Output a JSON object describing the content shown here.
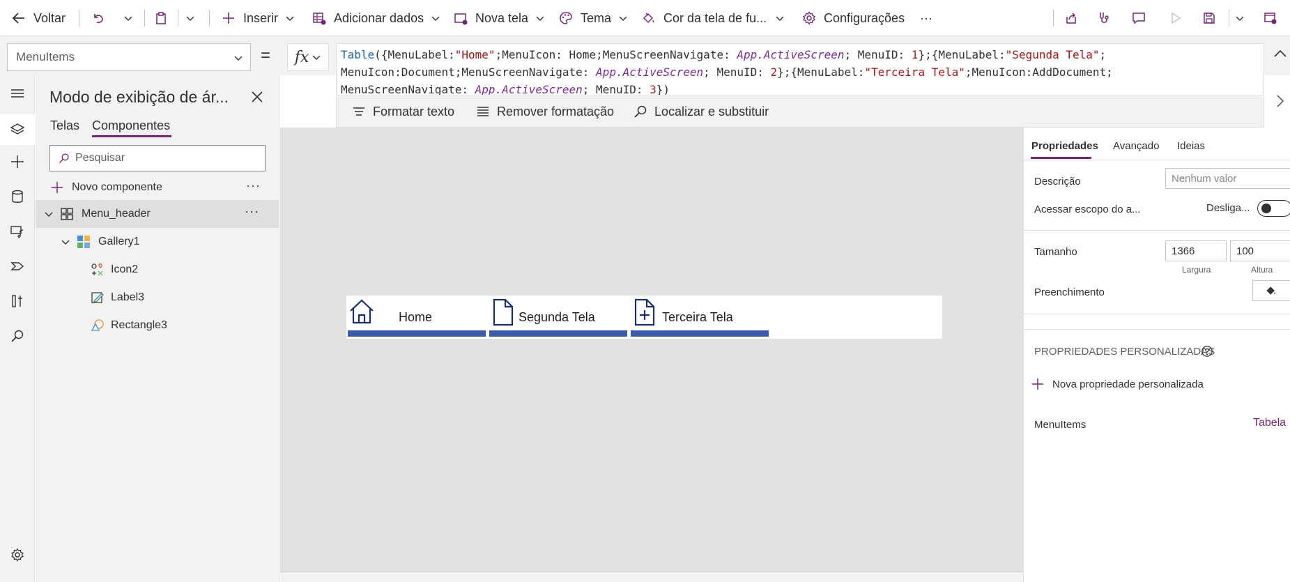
{
  "colors": {
    "accent": "#742774",
    "menu_bar": "#3a5ba7",
    "icon_navy": "#1c2e6e",
    "canvas_bg": "#e1e1e1",
    "panel_bg": "#f3f2f1"
  },
  "toolbar": {
    "back": "Voltar",
    "insert": "Inserir",
    "add_data": "Adicionar dados",
    "new_screen": "Nova tela",
    "theme": "Tema",
    "bg_color": "Cor da tela de fu...",
    "settings": "Configurações",
    "more": "···"
  },
  "formula_bar": {
    "property": "MenuItems",
    "equals": "=",
    "fx": "fx",
    "line1": {
      "fn": "Table",
      "p1": "({MenuLabel:",
      "s1": "\"Home\"",
      "p2": ";MenuIcon: Home;MenuScreenNavigate: ",
      "a1": "App.ActiveScreen",
      "p3": "; MenuID: ",
      "n1": "1",
      "p4": "};{MenuLabel:",
      "s2": "\"Segunda Tela\"",
      "p5": ";"
    },
    "line2": {
      "p1": "MenuIcon:Document;MenuScreenNavigate: ",
      "a1": "App.ActiveScreen",
      "p2": "; MenuID: ",
      "n1": "2",
      "p3": "};{MenuLabel:",
      "s1": "\"Terceira Tela\"",
      "p4": ";MenuIcon:AddDocument;"
    },
    "line3": {
      "p1": "MenuScreenNavigate: ",
      "a1": "App.ActiveScreen",
      "p2": "; MenuID: ",
      "n1": "3",
      "p3": "})"
    }
  },
  "format_toolbar": {
    "format_text": "Formatar texto",
    "remove_format": "Remover formatação",
    "find_replace": "Localizar e substituir"
  },
  "tree": {
    "title": "Modo de exibição de ár...",
    "tabs": {
      "screens": "Telas",
      "components": "Componentes"
    },
    "search_placeholder": "Pesquisar",
    "new_component": "Novo componente",
    "more": "···",
    "items": [
      {
        "label": "Menu_header",
        "icon": "component-icon"
      },
      {
        "label": "Gallery1",
        "icon": "gallery-icon"
      },
      {
        "label": "Icon2",
        "icon": "icon-control-icon"
      },
      {
        "label": "Label3",
        "icon": "label-icon"
      },
      {
        "label": "Rectangle3",
        "icon": "shape-icon"
      }
    ]
  },
  "canvas": {
    "menu": [
      {
        "label": "Home",
        "icon": "home-icon"
      },
      {
        "label": "Segunda Tela",
        "icon": "document-icon"
      },
      {
        "label": "Terceira Tela",
        "icon": "add-document-icon"
      }
    ]
  },
  "properties": {
    "tabs": {
      "properties": "Propriedades",
      "advanced": "Avançado",
      "ideas": "Ideias"
    },
    "description_label": "Descrição",
    "description_placeholder": "Nenhum valor",
    "access_scope_label": "Acessar escopo do a...",
    "access_scope_value": "Desliga...",
    "size_label": "Tamanho",
    "width_value": "1366",
    "height_value": "100",
    "width_label": "Largura",
    "height_label": "Altura",
    "fill_label": "Preenchimento",
    "custom_props_header": "PROPRIEDADES PERSONALIZADAS",
    "new_custom_prop": "Nova propriedade personalizada",
    "custom_prop_name": "MenuItems",
    "custom_prop_type": "Tabela"
  }
}
